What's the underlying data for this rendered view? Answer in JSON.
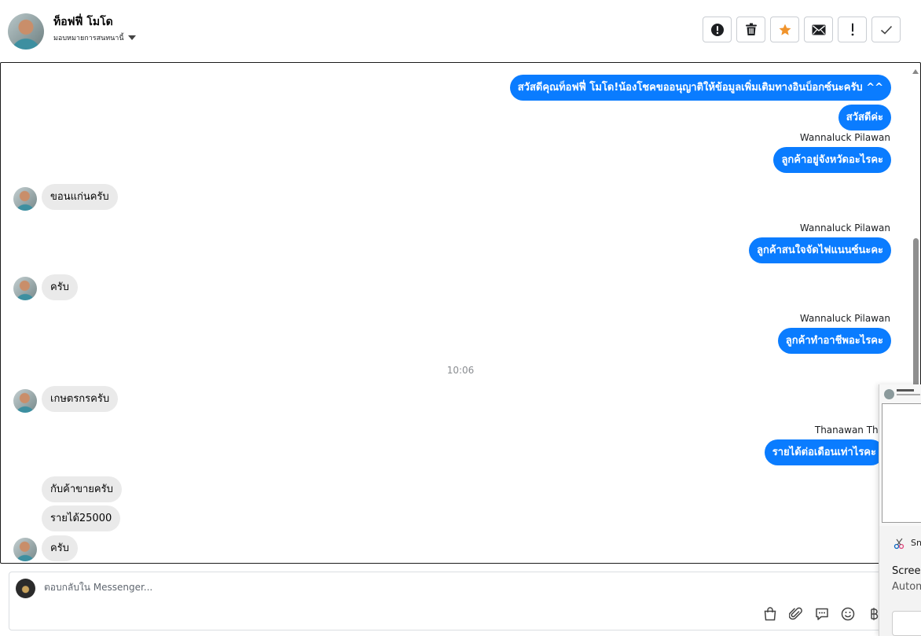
{
  "header": {
    "contact_name": "ท็อฟฟี่ โมโด",
    "assign_label": "มอบหมายการสนทนานี้",
    "actions": [
      {
        "name": "spam-icon"
      },
      {
        "name": "trash-icon"
      },
      {
        "name": "star-icon",
        "color": "#f0932b"
      },
      {
        "name": "mail-icon"
      },
      {
        "name": "important-icon"
      },
      {
        "name": "check-icon"
      }
    ]
  },
  "messages": {
    "m1": "สวัสดีคุณท็อฟฟี่ โมโด!น้องโชคขออนุญาติให้ข้อมูลเพิ่มเติมทางอินบ็อกซ์นะครับ ^^",
    "m2": "สวัสดีค่ะ",
    "s3": "Wannaluck Pilawan",
    "m3": "ลูกค้าอยู่จังหวัดอะไรคะ",
    "m4": "ขอนแก่นครับ",
    "s5": "Wannaluck Pilawan",
    "m5": "ลูกค้าสนใจจัดไฟแนนซ์นะคะ",
    "m6": "ครับ",
    "s7": "Wannaluck Pilawan",
    "m7": "ลูกค้าทำอาชีพอะไรคะ",
    "time": "10:06",
    "m8": "เกษตรกรครับ",
    "s9": "Thanawan Tho",
    "m9": "รายได้ต่อเดือนเท่าไรคะ",
    "m10": "กับค้าขายครับ",
    "m11": "รายได้25000",
    "m12": "ครับ"
  },
  "composer": {
    "placeholder": "ตอบกลับใน Messenger...",
    "tools": [
      "bag-icon",
      "paperclip-icon",
      "chat-bubble-icon",
      "emoji-icon",
      "baht-icon"
    ]
  },
  "overlay": {
    "app_name": "Sn",
    "title": "Screer",
    "subtitle": "Autom"
  },
  "colors": {
    "outgoing": "#0a7cff",
    "incoming": "#eaeaea",
    "star": "#f0932b"
  }
}
